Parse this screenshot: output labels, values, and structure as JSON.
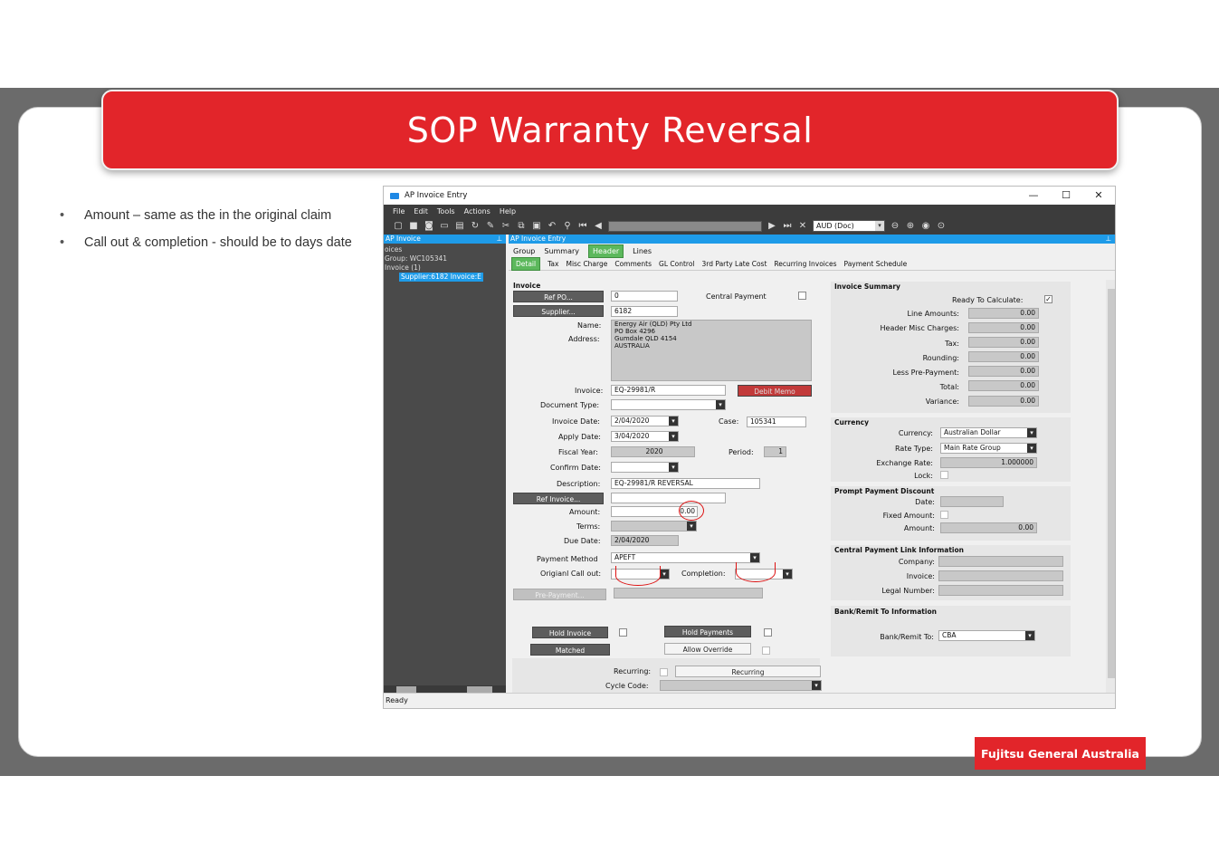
{
  "slide": {
    "title": "SOP Warranty Reversal",
    "bullets": [
      "Amount – same as the in the original claim",
      "Call out & completion - should be to days date"
    ],
    "brand": "Fujitsu General Australia",
    "accent_color": "#e2252a"
  },
  "window": {
    "title": "AP Invoice Entry",
    "controls": {
      "minimize": "—",
      "maximize": "☐",
      "close": "✕"
    },
    "menu": [
      "File",
      "Edit",
      "Tools",
      "Actions",
      "Help"
    ],
    "currency_combo": "AUD (Doc)",
    "left_panel": {
      "header": "AP Invoice",
      "tree": [
        "oices",
        "Group: WC105341",
        "Invoice (1)"
      ],
      "selected": "Supplier:6182 Invoice:E"
    },
    "main_header": "AP Invoice Entry",
    "tabs": [
      "Group",
      "Summary",
      "Header",
      "Lines"
    ],
    "active_tab": "Header",
    "subtabs": [
      "Detail",
      "Tax",
      "Misc Charge",
      "Comments",
      "GL Control",
      "3rd Party Late Cost",
      "Recurring Invoices",
      "Payment Schedule"
    ],
    "active_subtab": "Detail",
    "status": "Ready"
  },
  "invoice": {
    "section": "Invoice",
    "ref_po_btn": "Ref PO...",
    "ref_po": "0",
    "central_payment": "Central Payment",
    "supplier_btn": "Supplier...",
    "supplier": "6182",
    "name_lbl": "Name:",
    "address_lbl": "Address:",
    "name_address": [
      "Energy Air (QLD) Pty Ltd",
      "PO Box 4296",
      "Gumdale QLD 4154",
      "AUSTRALIA"
    ],
    "invoice_lbl": "Invoice:",
    "invoice": "EQ-29981/R",
    "debit_memo": "Debit Memo",
    "doc_type_lbl": "Document Type:",
    "inv_date_lbl": "Invoice Date:",
    "inv_date": "2/04/2020",
    "case_lbl": "Case:",
    "case": "105341",
    "apply_date_lbl": "Apply Date:",
    "apply_date": "3/04/2020",
    "fiscal_year_lbl": "Fiscal Year:",
    "fiscal_year": "2020",
    "period_lbl": "Period:",
    "period": "1",
    "confirm_date_lbl": "Confirm Date:",
    "description_lbl": "Description:",
    "description": "EQ-29981/R REVERSAL",
    "ref_invoice_btn": "Ref Invoice...",
    "amount_lbl": "Amount:",
    "amount": "0.00",
    "terms_lbl": "Terms:",
    "due_date_lbl": "Due Date:",
    "due_date": "2/04/2020",
    "payment_method_lbl": "Payment Method",
    "payment_method": "APEFT",
    "call_out_lbl": "Origianl Call out:",
    "completion_lbl": "Completion:",
    "pre_payment_btn": "Pre-Payment...",
    "hold_invoice_btn": "Hold Invoice",
    "hold_payments_btn": "Hold Payments",
    "matched_btn": "Matched",
    "allow_override_btn": "Allow Override",
    "recurring_lbl": "Recurring:",
    "recurring_btn": "Recurring",
    "cycle_code_lbl": "Cycle Code:"
  },
  "summary": {
    "header": "Invoice Summary",
    "ready_lbl": "Ready To Calculate:",
    "rows": [
      {
        "label": "Line Amounts:",
        "value": "0.00"
      },
      {
        "label": "Header Misc Charges:",
        "value": "0.00"
      },
      {
        "label": "Tax:",
        "value": "0.00"
      },
      {
        "label": "Rounding:",
        "value": "0.00"
      },
      {
        "label": "Less Pre-Payment:",
        "value": "0.00"
      },
      {
        "label": "Total:",
        "value": "0.00"
      },
      {
        "label": "Variance:",
        "value": "0.00"
      }
    ]
  },
  "currency": {
    "header": "Currency",
    "currency_lbl": "Currency:",
    "currency": "Australian Dollar",
    "rate_type_lbl": "Rate Type:",
    "rate_type": "Main Rate Group",
    "exchange_lbl": "Exchange Rate:",
    "exchange": "1.000000",
    "lock_lbl": "Lock:"
  },
  "prompt": {
    "header": "Prompt Payment Discount",
    "date_lbl": "Date:",
    "fixed_lbl": "Fixed Amount:",
    "amount_lbl": "Amount:",
    "amount": "0.00"
  },
  "central": {
    "header": "Central Payment Link Information",
    "company_lbl": "Company:",
    "invoice_lbl": "Invoice:",
    "legal_lbl": "Legal Number:"
  },
  "bank": {
    "header": "Bank/Remit To Information",
    "bank_lbl": "Bank/Remit To:",
    "bank": "CBA"
  }
}
